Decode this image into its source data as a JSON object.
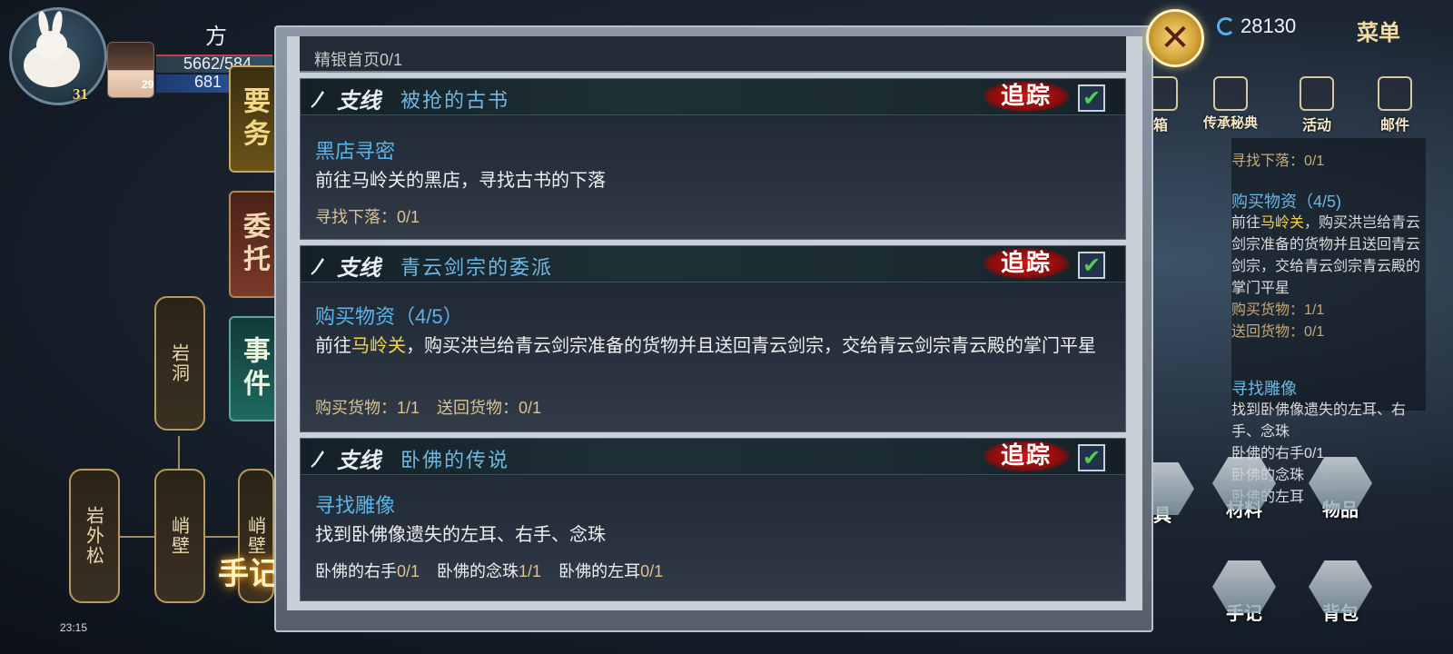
{
  "player": {
    "name": "方",
    "level": "31",
    "hero_level": "29",
    "hp_text": "5662/584",
    "mp_text": "681"
  },
  "side_tabs": [
    {
      "label": "要务"
    },
    {
      "label": "委托"
    },
    {
      "label": "事件"
    }
  ],
  "tree_nodes": [
    {
      "label": "岩洞"
    },
    {
      "label": "岩外松"
    },
    {
      "label": "峭壁"
    },
    {
      "label": "峭壁"
    }
  ],
  "journal_label": "手记",
  "status_time": "23:15",
  "hud": {
    "currency": "28130",
    "menu": "菜单",
    "top_icons": [
      {
        "label": "箱",
        "icon": "chest-icon"
      },
      {
        "label": "传承秘典",
        "icon": "scroll-book-icon"
      },
      {
        "label": "活动",
        "icon": "gift-icon"
      },
      {
        "label": "邮件",
        "icon": "mail-icon"
      }
    ]
  },
  "tracker": {
    "first_line": "寻找下落：0/1",
    "quests": [
      {
        "title": "购买物资（4/5)",
        "desc_pre": "前往",
        "desc_hl": "马岭关",
        "desc_post": "，购买洪岂给青云剑宗准备的货物并且送回青云剑宗，交给青云剑宗青云殿的掌门平星",
        "progress": [
          "购买货物：1/1",
          "送回货物：0/1"
        ]
      },
      {
        "title": "寻找雕像",
        "desc": "找到卧佛像遗失的左耳、右手、念珠",
        "progress": [
          "卧佛的右手0/1",
          "卧佛的念珠",
          "卧佛的左耳"
        ]
      }
    ]
  },
  "right_icons": [
    {
      "label": "具",
      "icon": "tools-icon"
    },
    {
      "label": "材料",
      "icon": "material-bag-icon"
    },
    {
      "label": "物品",
      "icon": "item-bag-icon"
    },
    {
      "label": "手记",
      "icon": "journal-icon"
    },
    {
      "label": "背包",
      "icon": "backpack-icon"
    }
  ],
  "panel": {
    "stub_text": "精银首页0/1",
    "quests": [
      {
        "type": "支线",
        "name": "被抢的古书",
        "track": "追踪",
        "checked": true,
        "step_title": "黑店寻密",
        "desc_pre": "前往马岭关的黑店，寻找古书的下落",
        "desc_hl": "",
        "desc_post": "",
        "progress": [
          {
            "name": "寻找下落：",
            "val": "0/1"
          }
        ]
      },
      {
        "type": "支线",
        "name": "青云剑宗的委派",
        "track": "追踪",
        "checked": true,
        "step_title": "购买物资（4/5）",
        "desc_pre": "前往",
        "desc_hl": "马岭关",
        "desc_post": "，购买洪岂给青云剑宗准备的货物并且送回青云剑宗，交给青云剑宗青云殿的掌门平星",
        "progress": [
          {
            "name": "购买货物：",
            "val": "1/1"
          },
          {
            "name": "送回货物：",
            "val": "0/1"
          }
        ]
      },
      {
        "type": "支线",
        "name": "卧佛的传说",
        "track": "追踪",
        "checked": true,
        "step_title": "寻找雕像",
        "desc_pre": "找到卧佛像遗失的左耳、右手、念珠",
        "desc_hl": "",
        "desc_post": "",
        "progress": [
          {
            "name": "卧佛的右手",
            "val": "0/1"
          },
          {
            "name": "卧佛的念珠",
            "val": "1/1"
          },
          {
            "name": "卧佛的左耳",
            "val": "0/1"
          }
        ]
      }
    ]
  },
  "colors": {
    "quest_name": "#6fb7e3",
    "highlight": "#f3d34a",
    "track_red": "#c81818",
    "check_green": "#4bd14b"
  }
}
